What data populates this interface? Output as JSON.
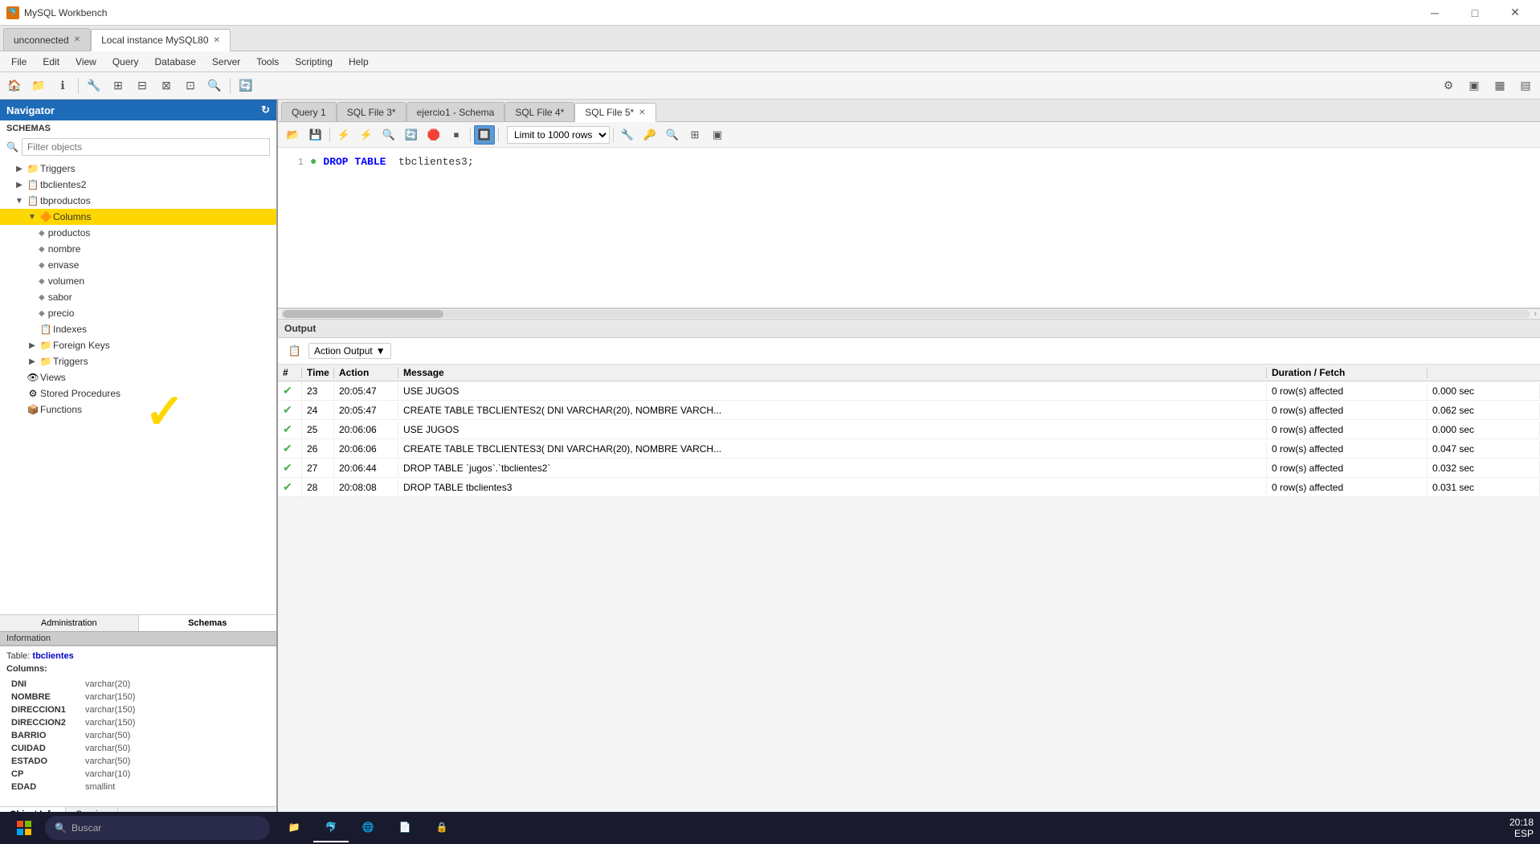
{
  "titleBar": {
    "title": "MySQL Workbench",
    "icon": "🐬",
    "minBtn": "─",
    "maxBtn": "□",
    "closeBtn": "✕"
  },
  "instanceTabs": [
    {
      "id": "unconnected",
      "label": "unconnected",
      "active": false
    },
    {
      "id": "local-mysql80",
      "label": "Local instance MySQL80",
      "active": true
    }
  ],
  "menuBar": {
    "items": [
      "File",
      "Edit",
      "View",
      "Query",
      "Database",
      "Server",
      "Tools",
      "Scripting",
      "Help"
    ]
  },
  "toolbar": {
    "buttons": [
      "📁",
      "💾",
      "ℹ",
      "🔧",
      "⊞",
      "⊟",
      "⊠",
      "⊡",
      "🔍",
      "🔄"
    ]
  },
  "sidebar": {
    "title": "Navigator",
    "searchPlaceholder": "Filter objects",
    "sections": {
      "schemas": "SCHEMAS"
    },
    "treeItems": [
      {
        "level": 1,
        "type": "expand",
        "arrow": "▶",
        "icon": "📁",
        "label": "Triggers"
      },
      {
        "level": 1,
        "type": "expand",
        "arrow": "▶",
        "icon": "📋",
        "label": "tbclientes2"
      },
      {
        "level": 1,
        "type": "collapse",
        "arrow": "▼",
        "icon": "📋",
        "label": "tbproductos"
      },
      {
        "level": 2,
        "type": "collapse",
        "arrow": "▼",
        "icon": "🔶",
        "label": "Columns",
        "selected": true
      },
      {
        "level": 3,
        "type": "leaf",
        "arrow": "",
        "icon": "◆",
        "label": "productos"
      },
      {
        "level": 3,
        "type": "leaf",
        "arrow": "",
        "icon": "◆",
        "label": "nombre"
      },
      {
        "level": 3,
        "type": "leaf",
        "arrow": "",
        "icon": "◆",
        "label": "envase"
      },
      {
        "level": 3,
        "type": "leaf",
        "arrow": "",
        "icon": "◆",
        "label": "volumen"
      },
      {
        "level": 3,
        "type": "leaf",
        "arrow": "",
        "icon": "◆",
        "label": "sabor"
      },
      {
        "level": 3,
        "type": "leaf",
        "arrow": "",
        "icon": "◆",
        "label": "precio"
      },
      {
        "level": 2,
        "type": "leaf",
        "arrow": "",
        "icon": "📋",
        "label": "Indexes"
      },
      {
        "level": 2,
        "type": "expand",
        "arrow": "▶",
        "icon": "📁",
        "label": "Foreign Keys"
      },
      {
        "level": 2,
        "type": "expand",
        "arrow": "▶",
        "icon": "📁",
        "label": "Triggers"
      },
      {
        "level": 1,
        "type": "leaf",
        "arrow": "",
        "icon": "👁",
        "label": "Views"
      },
      {
        "level": 1,
        "type": "leaf",
        "arrow": "",
        "icon": "⚙",
        "label": "Stored Procedures"
      },
      {
        "level": 1,
        "type": "leaf",
        "arrow": "",
        "icon": "📦",
        "label": "Functions"
      }
    ],
    "bottomTabs": [
      "Administration",
      "Schemas"
    ],
    "activeBottomTab": "Schemas"
  },
  "infoPanel": {
    "title": "Information",
    "tableLabel": "Table: tbclientes",
    "columnsLabel": "Columns:",
    "columns": [
      {
        "name": "DNI",
        "type": "varchar(20)"
      },
      {
        "name": "NOMBRE",
        "type": "varchar(150)"
      },
      {
        "name": "DIRECCION1",
        "type": "varchar(150)"
      },
      {
        "name": "DIRECCION2",
        "type": "varchar(150)"
      },
      {
        "name": "BARRIO",
        "type": "varchar(50)"
      },
      {
        "name": "CUIDAD",
        "type": "varchar(50)"
      },
      {
        "name": "ESTADO",
        "type": "varchar(50)"
      },
      {
        "name": "CP",
        "type": "varchar(10)"
      },
      {
        "name": "EDAD",
        "type": "smallint"
      }
    ]
  },
  "bottomInfoTabs": [
    "Object Info",
    "Session"
  ],
  "activeBottomInfoTab": "Object Info",
  "queryTabs": [
    {
      "id": "query1",
      "label": "Query 1",
      "active": false
    },
    {
      "id": "sqlfile3",
      "label": "SQL File 3*",
      "active": false
    },
    {
      "id": "ejercio1",
      "label": "ejercio1 - Schema",
      "active": false
    },
    {
      "id": "sqlfile4",
      "label": "SQL File 4*",
      "active": false
    },
    {
      "id": "sqlfile5",
      "label": "SQL File 5*",
      "active": true,
      "closeable": true
    }
  ],
  "sqlToolbar": {
    "buttons": [
      "📂",
      "💾",
      "⚡",
      "⚡",
      "🔍",
      "🔄",
      "🛑",
      "⏹",
      "🔲",
      "🔲",
      "🔍",
      "⊞",
      "▣"
    ],
    "limitLabel": "Limit to 1000 rows",
    "limitValue": "1000"
  },
  "sqlEditor": {
    "lines": [
      {
        "num": 1,
        "hasMarker": true,
        "content": "DROP TABLE  tbclientes3;"
      }
    ]
  },
  "output": {
    "title": "Output",
    "actionOutputLabel": "Action Output",
    "columns": [
      "#",
      "Time",
      "Action",
      "Message",
      "Duration / Fetch"
    ],
    "rows": [
      {
        "num": 23,
        "time": "20:05:47",
        "action": "USE JUGOS",
        "message": "0 row(s) affected",
        "duration": "0.000 sec",
        "ok": true
      },
      {
        "num": 24,
        "time": "20:05:47",
        "action": "CREATE TABLE TBCLIENTES2( DNI VARCHAR(20), NOMBRE VARCH...",
        "message": "0 row(s) affected",
        "duration": "0.062 sec",
        "ok": true
      },
      {
        "num": 25,
        "time": "20:06:06",
        "action": "USE JUGOS",
        "message": "0 row(s) affected",
        "duration": "0.000 sec",
        "ok": true
      },
      {
        "num": 26,
        "time": "20:06:06",
        "action": "CREATE TABLE TBCLIENTES3( DNI VARCHAR(20), NOMBRE VARCH...",
        "message": "0 row(s) affected",
        "duration": "0.047 sec",
        "ok": true
      },
      {
        "num": 27,
        "time": "20:06:44",
        "action": "DROP TABLE `jugos`.`tbclientes2`",
        "message": "0 row(s) affected",
        "duration": "0.032 sec",
        "ok": true
      },
      {
        "num": 28,
        "time": "20:08:08",
        "action": "DROP TABLE tbclientes3",
        "message": "0 row(s) affected",
        "duration": "0.031 sec",
        "ok": true
      }
    ]
  },
  "taskbar": {
    "searchPlaceholder": "Buscar",
    "time": "20:18",
    "language": "ESP"
  }
}
